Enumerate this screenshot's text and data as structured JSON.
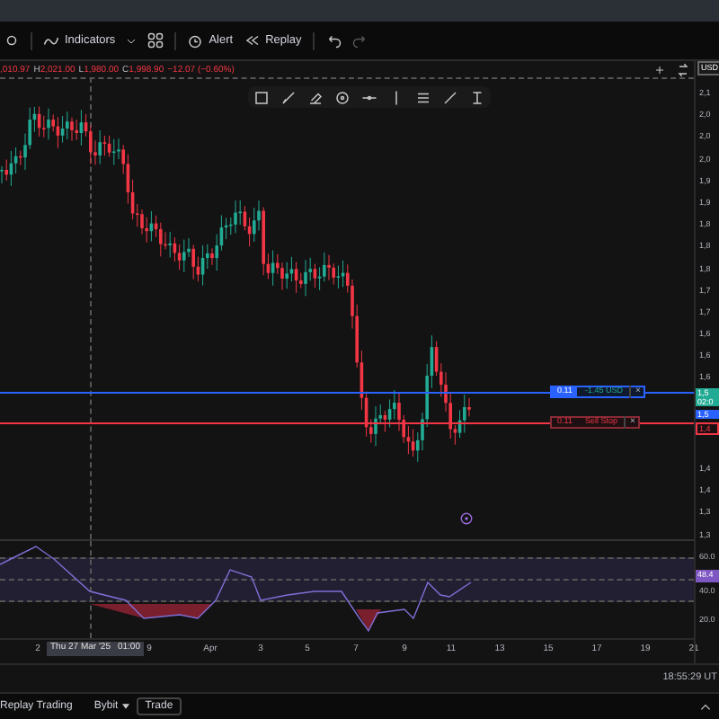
{
  "toolbar": {
    "indicators": "Indicators",
    "alert": "Alert",
    "replay": "Replay"
  },
  "legend": {
    "items": [
      {
        "value": ",010.97"
      },
      {
        "label": "H",
        "value": "2,021.00"
      },
      {
        "label": "L",
        "value": "1,980.00"
      },
      {
        "label": "C",
        "value": "1,998.90"
      }
    ],
    "change": "−12.07 (−0.60%)"
  },
  "currency": "USD",
  "price_axis": {
    "upper_labels": [
      "2,1",
      "2,0",
      "2,0",
      "2,0",
      "1,9",
      "1,9",
      "1,8",
      "1,8",
      "1,8",
      "1,7",
      "1,7",
      "1,6",
      "1,6",
      "1,6"
    ],
    "lower_labels": [
      "1,4",
      "1,4",
      "1,3",
      "1,3"
    ]
  },
  "orders": [
    {
      "kind": "position",
      "quantity": "0.11",
      "text": "-1.45 USD",
      "close": "×"
    },
    {
      "kind": "order",
      "quantity": "0.11",
      "text": "Sell Stop",
      "close": "×"
    }
  ],
  "price_tags": [
    {
      "kind": "last",
      "text": "1,5",
      "subtext": "02:0"
    },
    {
      "kind": "position",
      "text": "1,5"
    },
    {
      "kind": "order",
      "text": "1,4"
    }
  ],
  "rsi_axis": {
    "labels": [
      "60.0",
      "40.0",
      "20.0"
    ],
    "current": "48.4"
  },
  "time_axis": {
    "ticks": [
      "2",
      "9",
      "Apr",
      "3",
      "5",
      "7",
      "9",
      "11",
      "13",
      "15",
      "17",
      "19",
      "21"
    ],
    "crosshair_date": "Thu 27 Mar '25",
    "crosshair_time": "01:00"
  },
  "clock": "18:55:29 UT",
  "bottom_bar": {
    "tabs": [
      "Replay Trading",
      "Bybit"
    ],
    "trade": "Trade"
  }
}
